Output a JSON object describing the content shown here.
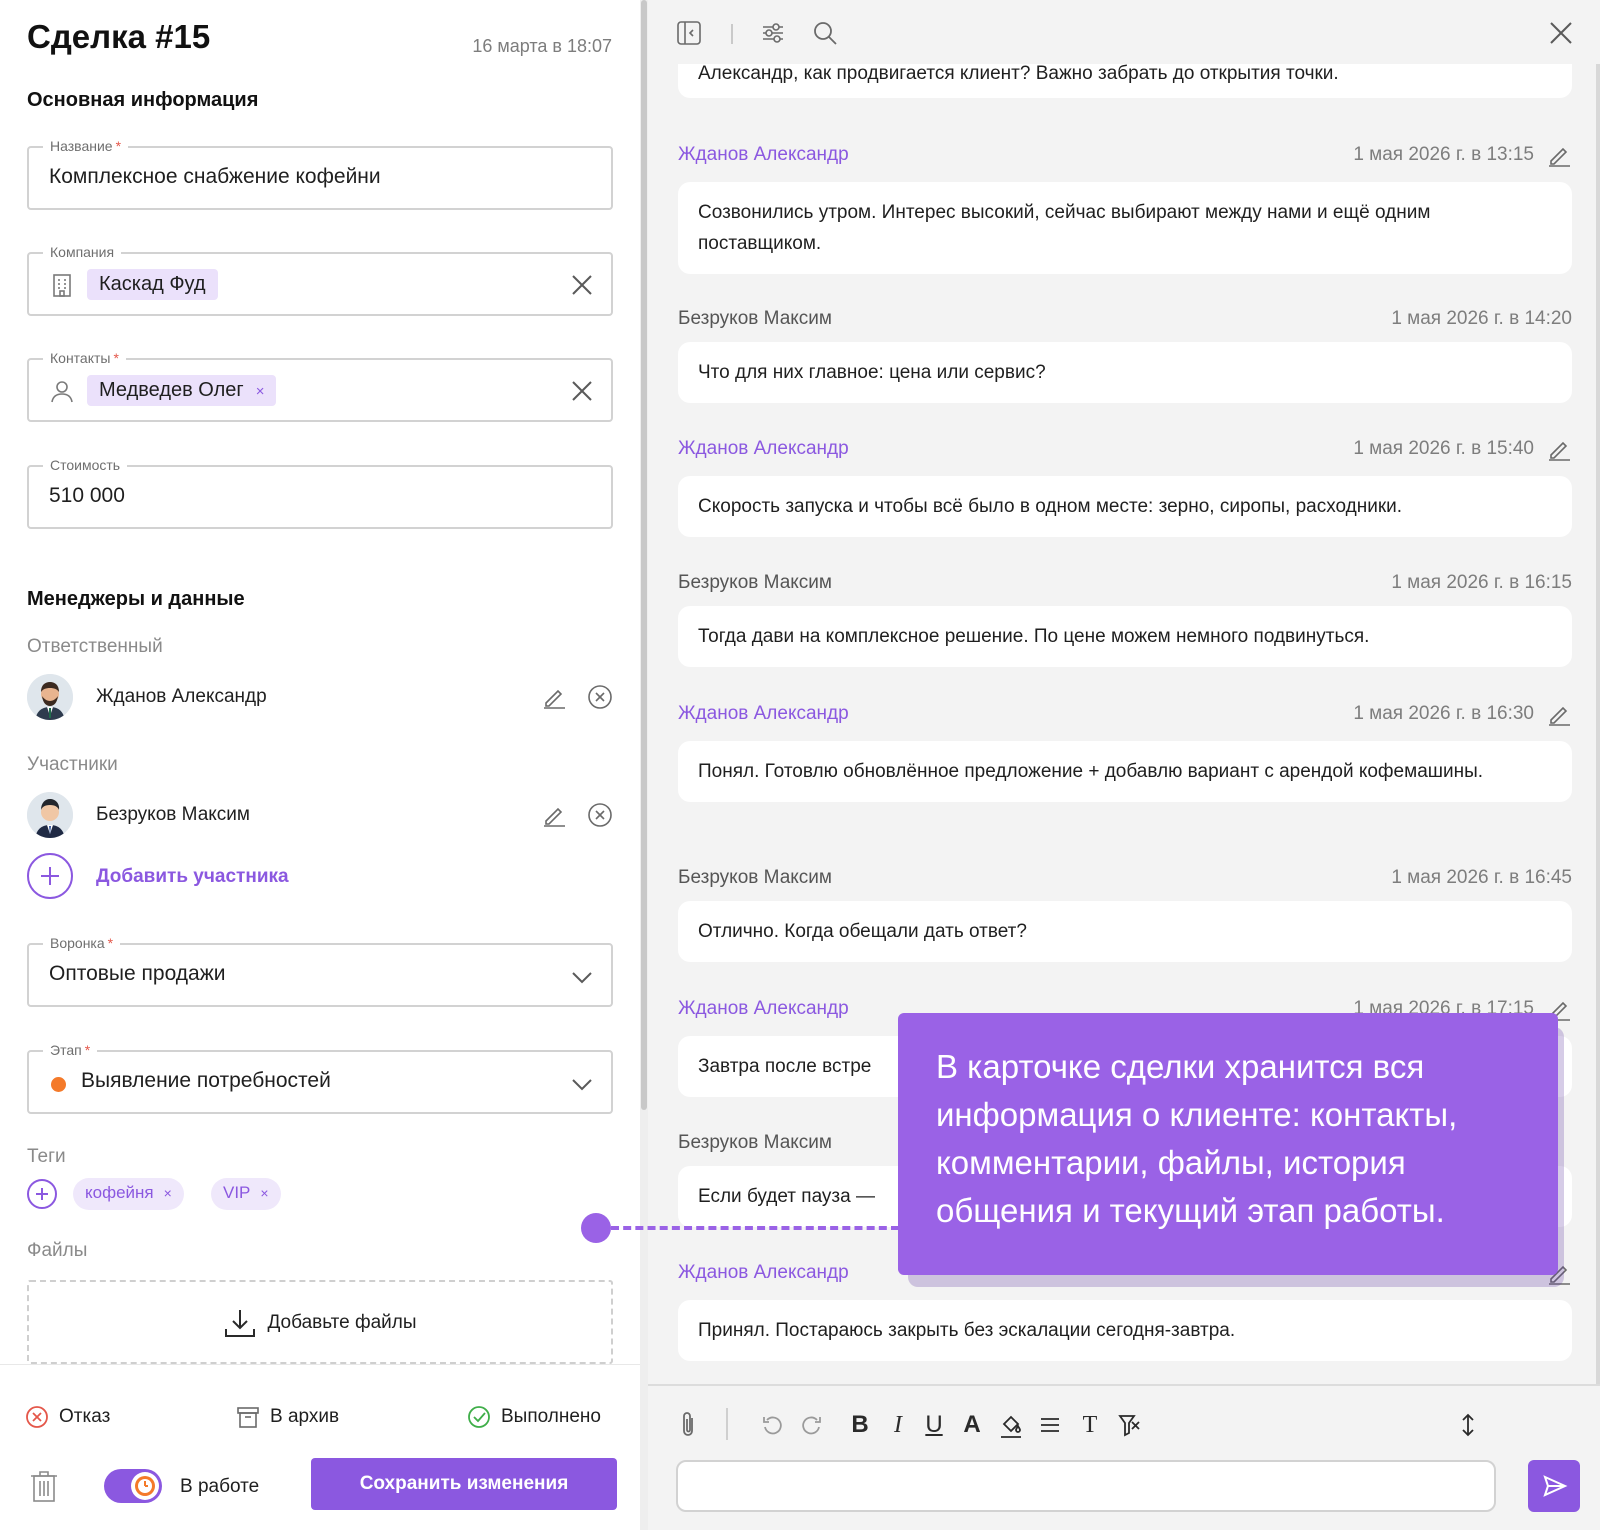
{
  "deal": {
    "title": "Сделка #15",
    "date": "16 марта в 18:07"
  },
  "sections": {
    "main": "Основная информация",
    "managers": "Менеджеры и данные"
  },
  "fields": {
    "name": {
      "label": "Название",
      "value": "Комплексное снабжение кофейни",
      "required": true
    },
    "company": {
      "label": "Компания",
      "chip": "Каскад Фуд"
    },
    "contacts": {
      "label": "Контакты",
      "chip": "Медведев Олег",
      "chip_remove": "×",
      "required": true
    },
    "cost": {
      "label": "Стоимость",
      "value": "510 000"
    },
    "funnel": {
      "label": "Воронка",
      "value": "Оптовые продажи",
      "required": true
    },
    "stage": {
      "label": "Этап",
      "value": "Выявление потребностей",
      "required": true,
      "dot_color": "#f47a2a"
    }
  },
  "required_mark": "*",
  "responsible": {
    "label": "Ответственный",
    "name": "Жданов Александр"
  },
  "participants": {
    "label": "Участники",
    "items": [
      {
        "name": "Безруков Максим"
      }
    ],
    "add_label": "Добавить участника"
  },
  "tags": {
    "label": "Теги",
    "items": [
      "кофейня",
      "VIP"
    ],
    "remove": "×"
  },
  "files": {
    "label": "Файлы",
    "dropzone": "Добавьте файлы"
  },
  "footer": {
    "reject": "Отказ",
    "archive": "В архив",
    "done": "Выполнено",
    "toggle_label": "В работе",
    "save": "Сохранить изменения"
  },
  "messages": [
    {
      "author": "",
      "time": "",
      "text": "Александр, как продвигается клиент? Важно забрать до открытия точки.",
      "own": false
    },
    {
      "author": "Жданов Александр",
      "time": "1 мая 2026 г. в 13:15",
      "text": "Созвонились утром. Интерес высокий, сейчас выбирают между нами и ещё одним поставщиком.",
      "own": true
    },
    {
      "author": "Безруков Максим",
      "time": "1 мая 2026 г. в 14:20",
      "text": "Что для них главное: цена или сервис?",
      "own": false
    },
    {
      "author": "Жданов Александр",
      "time": "1 мая 2026 г. в 15:40",
      "text": "Скорость запуска и чтобы всё было в одном месте: зерно, сиропы, расходники.",
      "own": true
    },
    {
      "author": "Безруков Максим",
      "time": "1 мая 2026 г. в 16:15",
      "text": "Тогда дави на комплексное решение. По цене можем немного подвинуться.",
      "own": false
    },
    {
      "author": "Жданов Александр",
      "time": "1 мая 2026 г. в 16:30",
      "text": "Понял. Готовлю обновлённое предложение + добавлю вариант с арендой кофемашины.",
      "own": true
    },
    {
      "author": "Безруков Максим",
      "time": "1 мая 2026 г. в 16:45",
      "text": "Отлично. Когда обещали дать ответ?",
      "own": false
    },
    {
      "author": "Жданов Александр",
      "time": "1 мая 2026 г. в 17:15",
      "text": "Завтра после встре",
      "own": true
    },
    {
      "author": "Безруков Максим",
      "time": "",
      "text": "Если будет пауза —",
      "own": false
    },
    {
      "author": "Жданов Александр",
      "time": "",
      "text": "Принял. Постараюсь закрыть без эскалации сегодня-завтра.",
      "own": true
    }
  ],
  "callout": {
    "text": "В карточке сделки хранится вся информация о клиенте: контакты, комментарии, файлы, история общения и текущий этап работы."
  },
  "colors": {
    "accent": "#8b58e0",
    "callout": "#9a62e6",
    "stage_dot": "#f47a2a",
    "reject": "#e4574a",
    "done": "#3fae49"
  }
}
